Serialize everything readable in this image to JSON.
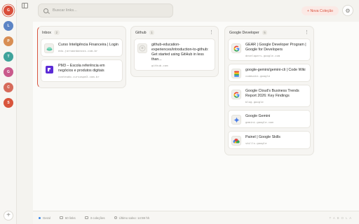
{
  "workspaces": [
    {
      "letter": "G",
      "color": "#d94d3a",
      "active": true
    },
    {
      "letter": "L",
      "color": "#5c84c5"
    },
    {
      "letter": "P",
      "color": "#d88e54"
    },
    {
      "letter": "T",
      "color": "#3fa39b"
    },
    {
      "letter": "G",
      "color": "#c95a8c"
    },
    {
      "letter": "C",
      "color": "#d66b5b"
    },
    {
      "letter": "S",
      "color": "#d9553c"
    }
  ],
  "add_workspace_label": "+",
  "search": {
    "placeholder": "Buscar links..."
  },
  "new_collection_label": "+ Nova Coleção",
  "settings_icon": "⚙",
  "collections": [
    {
      "name": "Inbox",
      "count": "2",
      "links": [
        {
          "title": "Curso Inteligência Financeira | Login",
          "url": "edu.jornaonbancos.com.br",
          "icon": "money"
        },
        {
          "title": "PM3 – Escola referência em negócios e produtos digitais",
          "url": "conteudo.cursospm3.com.br",
          "icon": "pm3"
        }
      ]
    },
    {
      "name": "Github",
      "count": "1",
      "menu": "⋮",
      "links": [
        {
          "title": "github-education-experiences/introduction-to-github: Get started using GitHub in less than...",
          "url": "github.com",
          "icon": "github"
        }
      ]
    },
    {
      "name": "Google Developer",
      "count": "5",
      "menu": "⋮",
      "links": [
        {
          "title": "GEAR | Google Developer Program | Google for Developers",
          "url": "developers.google.com",
          "icon": "google"
        },
        {
          "title": "google-gemini/gemini-cli | Code Wiki",
          "url": "codewiki.google",
          "icon": "wiki"
        },
        {
          "title": "Google Cloud's Business Trends Report 2026: Key Findings",
          "url": "blog.google",
          "icon": "google"
        },
        {
          "title": "Google Gemini",
          "url": "gemini.google.com",
          "icon": "gemini"
        },
        {
          "title": "Painel | Google Skills",
          "url": "skills.google",
          "icon": "skills"
        }
      ]
    }
  ],
  "status": {
    "view": "Geral",
    "links": "60 links",
    "collections": "3 coleções",
    "saved": "Último salvo: 14:59 hh"
  },
  "brand": "T A B O L A"
}
